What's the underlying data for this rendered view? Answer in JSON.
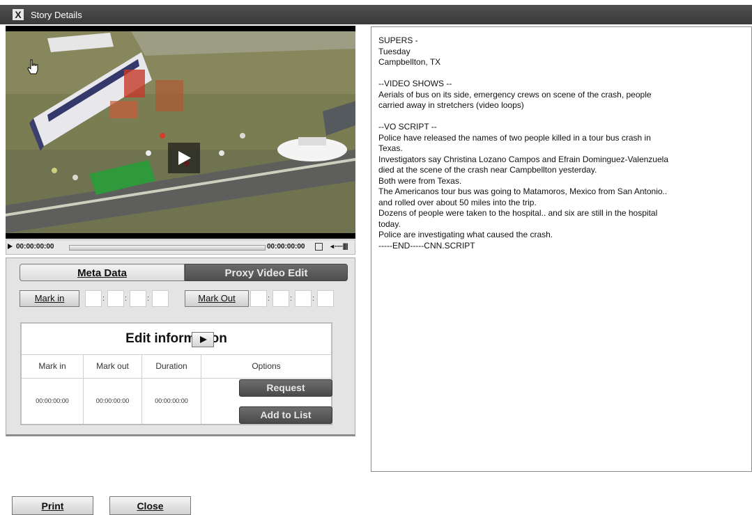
{
  "window": {
    "title": "Story Details",
    "close_glyph": "X"
  },
  "video": {
    "current_time": "00:00:00:00",
    "total_time": "00:00:00:00",
    "volume_glyph": "◂ ·····||||"
  },
  "tabs": {
    "meta": "Meta Data",
    "proxy": "Proxy Video Edit",
    "active": "proxy"
  },
  "marks": {
    "mark_in_label": "Mark in",
    "mark_out_label": "Mark Out",
    "separator": ":"
  },
  "edit_info": {
    "title": "Edit information",
    "columns": [
      "Mark in",
      "Mark out",
      "Duration",
      "Options"
    ],
    "row": {
      "mark_in": "00:00:00:00",
      "mark_out": "00:00:00:00",
      "duration": "00:00:00:00"
    },
    "request_label": "Request",
    "add_label": "Add to List"
  },
  "script_text": "SUPERS -\nTuesday\nCampbellton, TX\n\n--VIDEO SHOWS --\nAerials of bus on its side, emergency crews on scene of the crash, people\ncarried away in stretchers (video loops)\n\n--VO SCRIPT --\nPolice have released the names of two people killed in a tour bus crash in\nTexas.\nInvestigators say Christina Lozano Campos and Efrain Dominguez-Valenzuela\ndied at the scene of the crash near Campbellton yesterday.\nBoth were from Texas.\nThe Americanos tour bus was going to Matamoros, Mexico from San Antonio..\nand rolled over about 50 miles into the trip.\nDozens of people were taken to the hospital.. and six are still in the hospital\ntoday.\nPolice are investigating what caused the crash.\n-----END-----CNN.SCRIPT",
  "buttons": {
    "print": "Print",
    "close": "Close"
  },
  "colors": {
    "titlebar": "#444444",
    "tab_active": "#555555",
    "panel": "#e4e4e4"
  }
}
